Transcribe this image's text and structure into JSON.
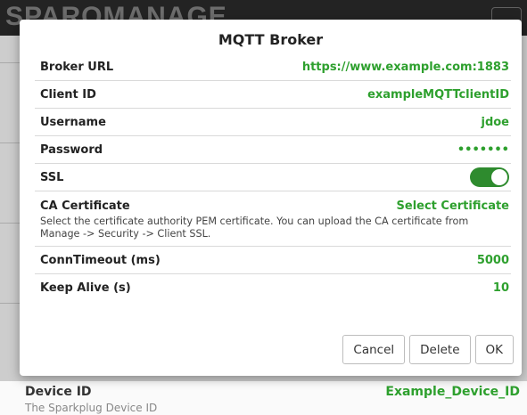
{
  "background": {
    "logo_text": "SPARQMANAGE",
    "device_field": {
      "label": "Device ID",
      "value": "Example_Device_ID",
      "description": "The Sparkplug Device ID"
    }
  },
  "dialog": {
    "title": "MQTT Broker",
    "rows": {
      "broker_url": {
        "label": "Broker URL",
        "value": "https://www.example.com:1883"
      },
      "client_id": {
        "label": "Client ID",
        "value": "exampleMQTTclientID"
      },
      "username": {
        "label": "Username",
        "value": "jdoe"
      },
      "password": {
        "label": "Password",
        "value": "•••••••"
      },
      "ssl": {
        "label": "SSL",
        "enabled": true
      },
      "ca_certificate": {
        "label": "CA Certificate",
        "action": "Select Certificate",
        "description": "Select the certificate authority PEM certificate. You can upload the CA certificate from Manage -> Security -> Client SSL."
      },
      "conn_timeout": {
        "label": "ConnTimeout (ms)",
        "value": "5000"
      },
      "keep_alive": {
        "label": "Keep Alive (s)",
        "value": "10"
      }
    },
    "buttons": {
      "cancel": "Cancel",
      "delete": "Delete",
      "ok": "OK"
    }
  },
  "colors": {
    "accent_green": "#2ea02e",
    "toggle_on": "#2e8b2e"
  }
}
